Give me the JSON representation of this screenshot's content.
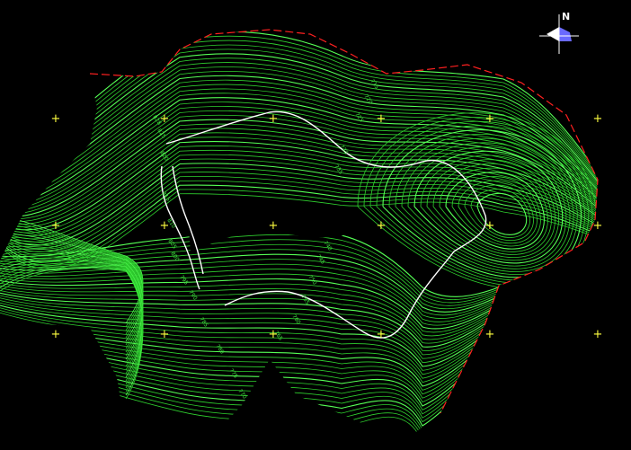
{
  "north_arrow": {
    "label": "N",
    "icon": "north-arrow-icon"
  },
  "colors": {
    "background": "#000000",
    "contour": "#2fd12f",
    "contour_bright": "#55ff55",
    "boundary": "#ff2020",
    "road": "#ffffff",
    "grid_mark": "#ffff40",
    "elevation_label": "#40e040"
  },
  "grid_marks": {
    "rows": 3,
    "cols": 6,
    "symbol": "+"
  },
  "elevation_labels": [
    {
      "text": "828"
    },
    {
      "text": "825"
    },
    {
      "text": "820"
    },
    {
      "text": "815"
    },
    {
      "text": "810"
    },
    {
      "text": "805"
    },
    {
      "text": "800"
    },
    {
      "text": "795"
    },
    {
      "text": "790"
    },
    {
      "text": "785"
    },
    {
      "text": "780"
    },
    {
      "text": "775"
    },
    {
      "text": "770"
    },
    {
      "text": "765"
    },
    {
      "text": "760"
    },
    {
      "text": "755"
    },
    {
      "text": "750"
    },
    {
      "text": "745"
    },
    {
      "text": "740"
    },
    {
      "text": "735"
    },
    {
      "text": "730"
    },
    {
      "text": "725"
    },
    {
      "text": "720"
    },
    {
      "text": "715"
    }
  ]
}
